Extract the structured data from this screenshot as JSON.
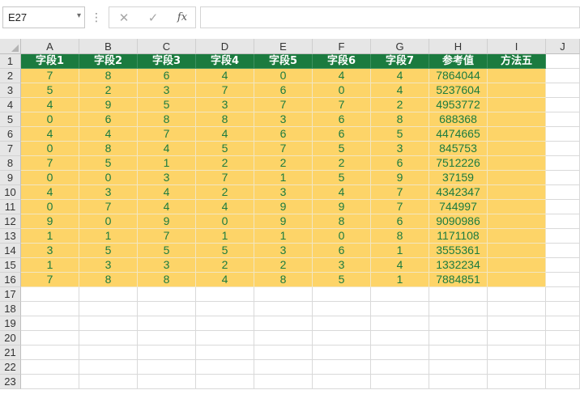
{
  "formula_bar": {
    "name_box": "E27",
    "name_box_icon": "chevron-down-icon",
    "separator_icon": "vertical-dots-icon",
    "cancel_icon": "close-icon",
    "enter_icon": "checkmark-icon",
    "fx_label": "fx",
    "formula_value": ""
  },
  "columns": [
    "A",
    "B",
    "C",
    "D",
    "E",
    "F",
    "G",
    "H",
    "I",
    "J"
  ],
  "row_numbers": [
    "1",
    "2",
    "3",
    "4",
    "5",
    "6",
    "7",
    "8",
    "9",
    "10",
    "11",
    "12",
    "13",
    "14",
    "15",
    "16",
    "17",
    "18",
    "19",
    "20",
    "21",
    "22",
    "23"
  ],
  "header_row": [
    "字段1",
    "字段2",
    "字段3",
    "字段4",
    "字段5",
    "字段6",
    "字段7",
    "参考值",
    "方法五"
  ],
  "data_rows": [
    [
      "7",
      "8",
      "6",
      "4",
      "0",
      "4",
      "4",
      "7864044",
      ""
    ],
    [
      "5",
      "2",
      "3",
      "7",
      "6",
      "0",
      "4",
      "5237604",
      ""
    ],
    [
      "4",
      "9",
      "5",
      "3",
      "7",
      "7",
      "2",
      "4953772",
      ""
    ],
    [
      "0",
      "6",
      "8",
      "8",
      "3",
      "6",
      "8",
      "688368",
      ""
    ],
    [
      "4",
      "4",
      "7",
      "4",
      "6",
      "6",
      "5",
      "4474665",
      ""
    ],
    [
      "0",
      "8",
      "4",
      "5",
      "7",
      "5",
      "3",
      "845753",
      ""
    ],
    [
      "7",
      "5",
      "1",
      "2",
      "2",
      "2",
      "6",
      "7512226",
      ""
    ],
    [
      "0",
      "0",
      "3",
      "7",
      "1",
      "5",
      "9",
      "37159",
      ""
    ],
    [
      "4",
      "3",
      "4",
      "2",
      "3",
      "4",
      "7",
      "4342347",
      ""
    ],
    [
      "0",
      "7",
      "4",
      "4",
      "9",
      "9",
      "7",
      "744997",
      ""
    ],
    [
      "9",
      "0",
      "9",
      "0",
      "9",
      "8",
      "6",
      "9090986",
      ""
    ],
    [
      "1",
      "1",
      "7",
      "1",
      "1",
      "0",
      "8",
      "1171108",
      ""
    ],
    [
      "3",
      "5",
      "5",
      "5",
      "3",
      "6",
      "1",
      "3555361",
      ""
    ],
    [
      "1",
      "3",
      "3",
      "2",
      "2",
      "3",
      "4",
      "1332234",
      ""
    ],
    [
      "7",
      "8",
      "8",
      "4",
      "8",
      "5",
      "1",
      "7884851",
      ""
    ]
  ],
  "colors": {
    "header_fill": "#1b7b3f",
    "header_text": "#ffffff",
    "data_fill": "#fdd468",
    "data_text": "#1b7b3f"
  }
}
